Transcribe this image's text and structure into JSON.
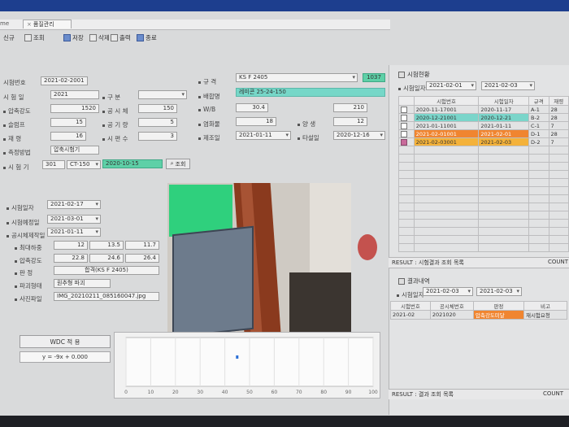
{
  "window": {
    "home_tab": "me",
    "active_tab": "품질관리"
  },
  "toolbar": [
    {
      "icon": "new-icon",
      "label": "신규"
    },
    {
      "icon": "search-icon",
      "label": "조회"
    },
    {
      "icon": "save-icon",
      "label": "저장"
    },
    {
      "icon": "delete-icon",
      "label": "삭제"
    },
    {
      "icon": "print-icon",
      "label": "출력"
    },
    {
      "icon": "close-icon",
      "label": "종료"
    }
  ],
  "form": {
    "row1": {
      "label_a": "시험번호",
      "value_a": "2021-02-2001",
      "label_b": "규 격",
      "value_b": "KS F 2405",
      "badge": "1037"
    },
    "row2": {
      "label_a": "시 험 일",
      "value_a": "2021",
      "label_b": "구 분",
      "value_b": "",
      "label_c": "배합명",
      "value_c": "레미콘 25-24-150"
    },
    "row3": {
      "label_a": "압축강도",
      "value_a": "1520",
      "label_b": "공 시 체",
      "value_b": "150",
      "label_c": "W/B",
      "value_c": "30.4",
      "value_d": "210"
    },
    "row4": {
      "label_a": "슬럼프",
      "value_a": "15",
      "label_b": "공 기 량",
      "value_b": "5",
      "label_c": "염화물",
      "value_c": "18",
      "label_d": "양 생",
      "value_d": "12"
    },
    "row5": {
      "label_a": "재 령",
      "value_a": "16",
      "label_b": "시 편 수",
      "value_b": "3",
      "label_c": "제조일",
      "value_c": "2021-01-11",
      "label_d": "타설일",
      "value_d": "2020-12-16"
    },
    "row6": {
      "label_a": "측정방법",
      "value_a": "압축시험기"
    },
    "row7": {
      "label_a": "시 험 기",
      "value_a": "301",
      "value_b": "CT-150",
      "value_c": "2020-10-15",
      "button": "조회"
    }
  },
  "lower_form": [
    {
      "label": "시험일자",
      "value": "2021-02-17"
    },
    {
      "label": "시험예정일",
      "value": "2021-03-01"
    },
    {
      "label": "공시체제작일",
      "value": "2021-01-11"
    }
  ],
  "measure": {
    "label_a": "최대하중",
    "values_a": [
      "12",
      "13.5",
      "11.7"
    ],
    "label_b": "압축강도",
    "values_b": [
      "22.8",
      "24.6",
      "26.4"
    ],
    "label_c": "판 정",
    "value_c": "합격(KS F 2405)",
    "label_d": "파괴형태",
    "value_d": "원추형 파괴",
    "label_e": "사진파일",
    "value_e": "IMG_20210211_085160047.jpg"
  },
  "fit": {
    "title": "WDC 적 용",
    "formula": "y = -9x + 0.000"
  },
  "right": {
    "title": "시험현황",
    "date_label": "시험일자",
    "date_from": "2021-02-01",
    "date_to": "2021-02-03",
    "columns": [
      "",
      "시험번호",
      "시험일자",
      "규격",
      "재령"
    ],
    "rows": [
      {
        "cls": "",
        "chk": false,
        "no": "2020-11-17001",
        "date": "2020-11-17",
        "spec": "A-1",
        "age": "28"
      },
      {
        "cls": "teal",
        "chk": false,
        "no": "2020-12-21001",
        "date": "2020-12-21",
        "spec": "B-2",
        "age": "28"
      },
      {
        "cls": "",
        "chk": false,
        "no": "2021-01-11001",
        "date": "2021-01-11",
        "spec": "C-1",
        "age": "7"
      },
      {
        "cls": "orange",
        "chk": false,
        "no": "2021-02-01001",
        "date": "2021-02-01",
        "spec": "D-1",
        "age": "28"
      },
      {
        "cls": "yellow",
        "chk": true,
        "no": "2021-02-03001",
        "date": "2021-02-03",
        "spec": "D-2",
        "age": "7"
      }
    ],
    "result_label": "RESULT : 시험결과 조회 목록",
    "count_label": "COUNT",
    "section2_title": "결과내역",
    "date2_label": "시험일자",
    "date2_from": "2021-02-03",
    "date2_to": "2021-02-03",
    "columns2": [
      "시험번호",
      "공시체번호",
      "판정",
      "비고"
    ],
    "row2": {
      "no": "2021-02",
      "spec": "2021020",
      "judge": "압축강도미달",
      "note": "재시험요청"
    },
    "result2_label": "RESULT : 결과 조회 목록",
    "count2_label": "COUNT"
  },
  "chart_data": {
    "type": "scatter",
    "xticks": [
      "0",
      "10",
      "20",
      "30",
      "40",
      "50",
      "60",
      "70",
      "80",
      "90",
      "100"
    ],
    "points": [
      {
        "x": 45,
        "y": 0.6
      }
    ],
    "ylim": [
      0,
      1
    ],
    "xlim": [
      0,
      100
    ]
  },
  "colors": {
    "teal": "#76d7c8",
    "orange": "#f08530",
    "yellow": "#f4b23a",
    "blue_top": "#1d3e8e"
  }
}
